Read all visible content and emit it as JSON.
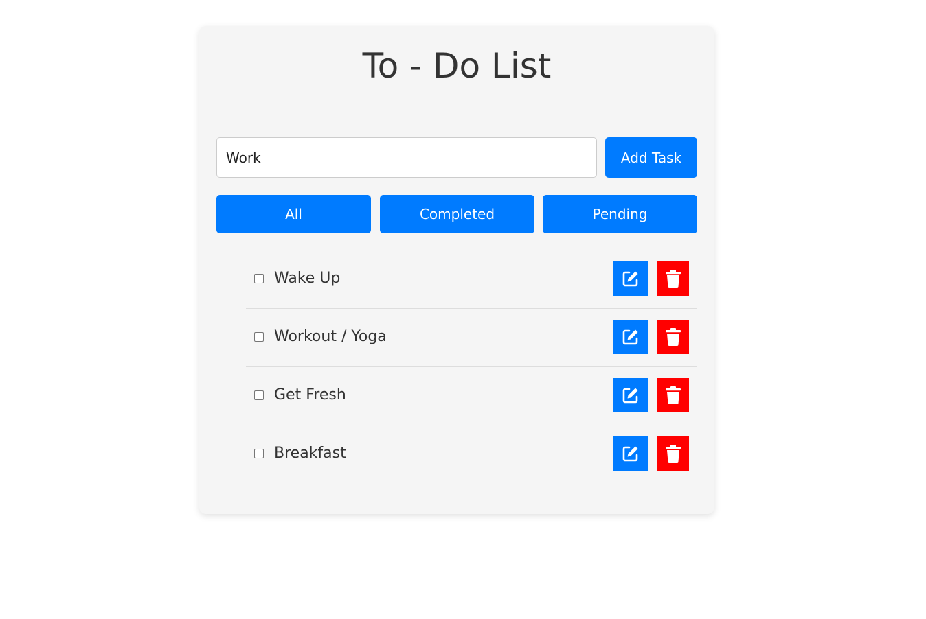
{
  "app": {
    "title": "To - Do List"
  },
  "input": {
    "value": "Work",
    "placeholder": ""
  },
  "buttons": {
    "add_label": "Add Task"
  },
  "filters": [
    {
      "label": "All"
    },
    {
      "label": "Completed"
    },
    {
      "label": "Pending"
    }
  ],
  "tasks": [
    {
      "text": "Wake Up",
      "completed": false
    },
    {
      "text": "Workout / Yoga",
      "completed": false
    },
    {
      "text": "Get Fresh",
      "completed": false
    },
    {
      "text": "Breakfast",
      "completed": false
    }
  ],
  "icons": {
    "edit": "edit-icon",
    "delete": "trash-icon"
  },
  "colors": {
    "primary": "#007bff",
    "danger": "#ff0000",
    "card_bg": "#f5f5f5",
    "title": "#333333"
  }
}
